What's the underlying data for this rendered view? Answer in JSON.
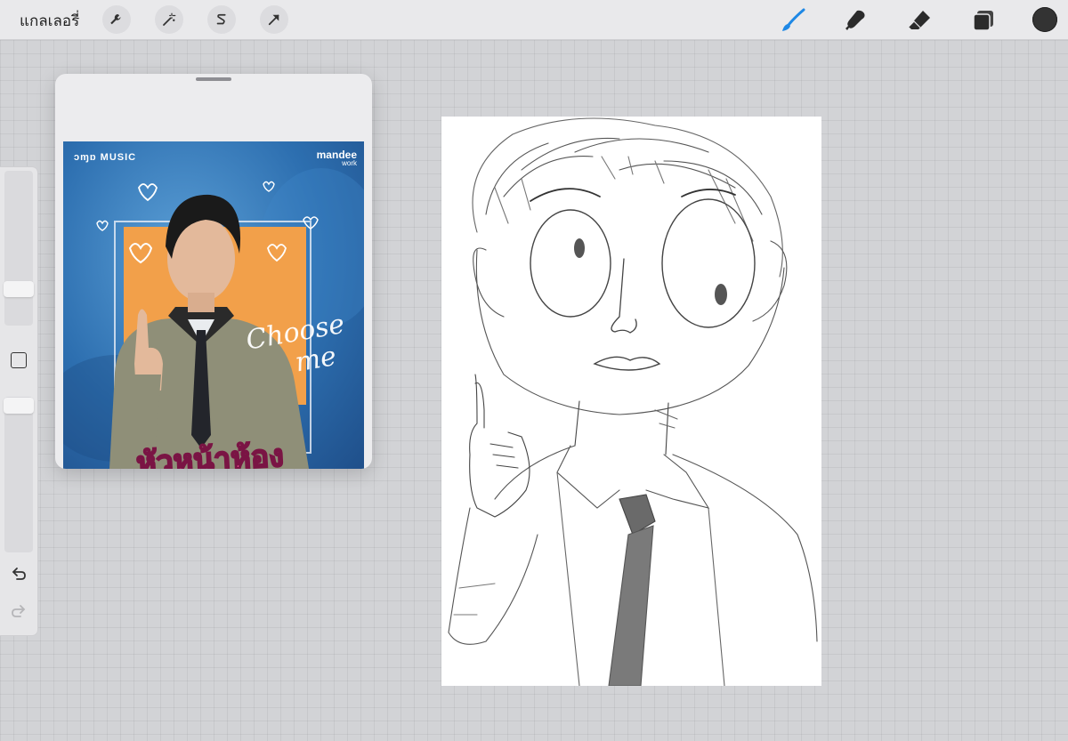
{
  "topbar": {
    "gallery_label": "แกลเลอรี่",
    "left_tools": [
      "wrench-icon",
      "magic-wand-icon",
      "selection-s-icon",
      "transform-arrow-icon"
    ],
    "right_tools": [
      "brush-icon",
      "smudge-icon",
      "eraser-icon",
      "layers-icon"
    ],
    "active_tool": "brush-icon",
    "active_tool_color": "#1e88e5",
    "current_color": "#333333"
  },
  "sidebar": {
    "size_slider_level": 0.75,
    "opacity_slider_level": 0.05
  },
  "reference": {
    "brand_left": "ɔɱɒ MUSIC",
    "brand_right": "mandee",
    "brand_right_sub": "work",
    "choose_text_line1": "Choose",
    "choose_text_line2": "me",
    "thai_title": "หัวหน้าห้อง"
  }
}
